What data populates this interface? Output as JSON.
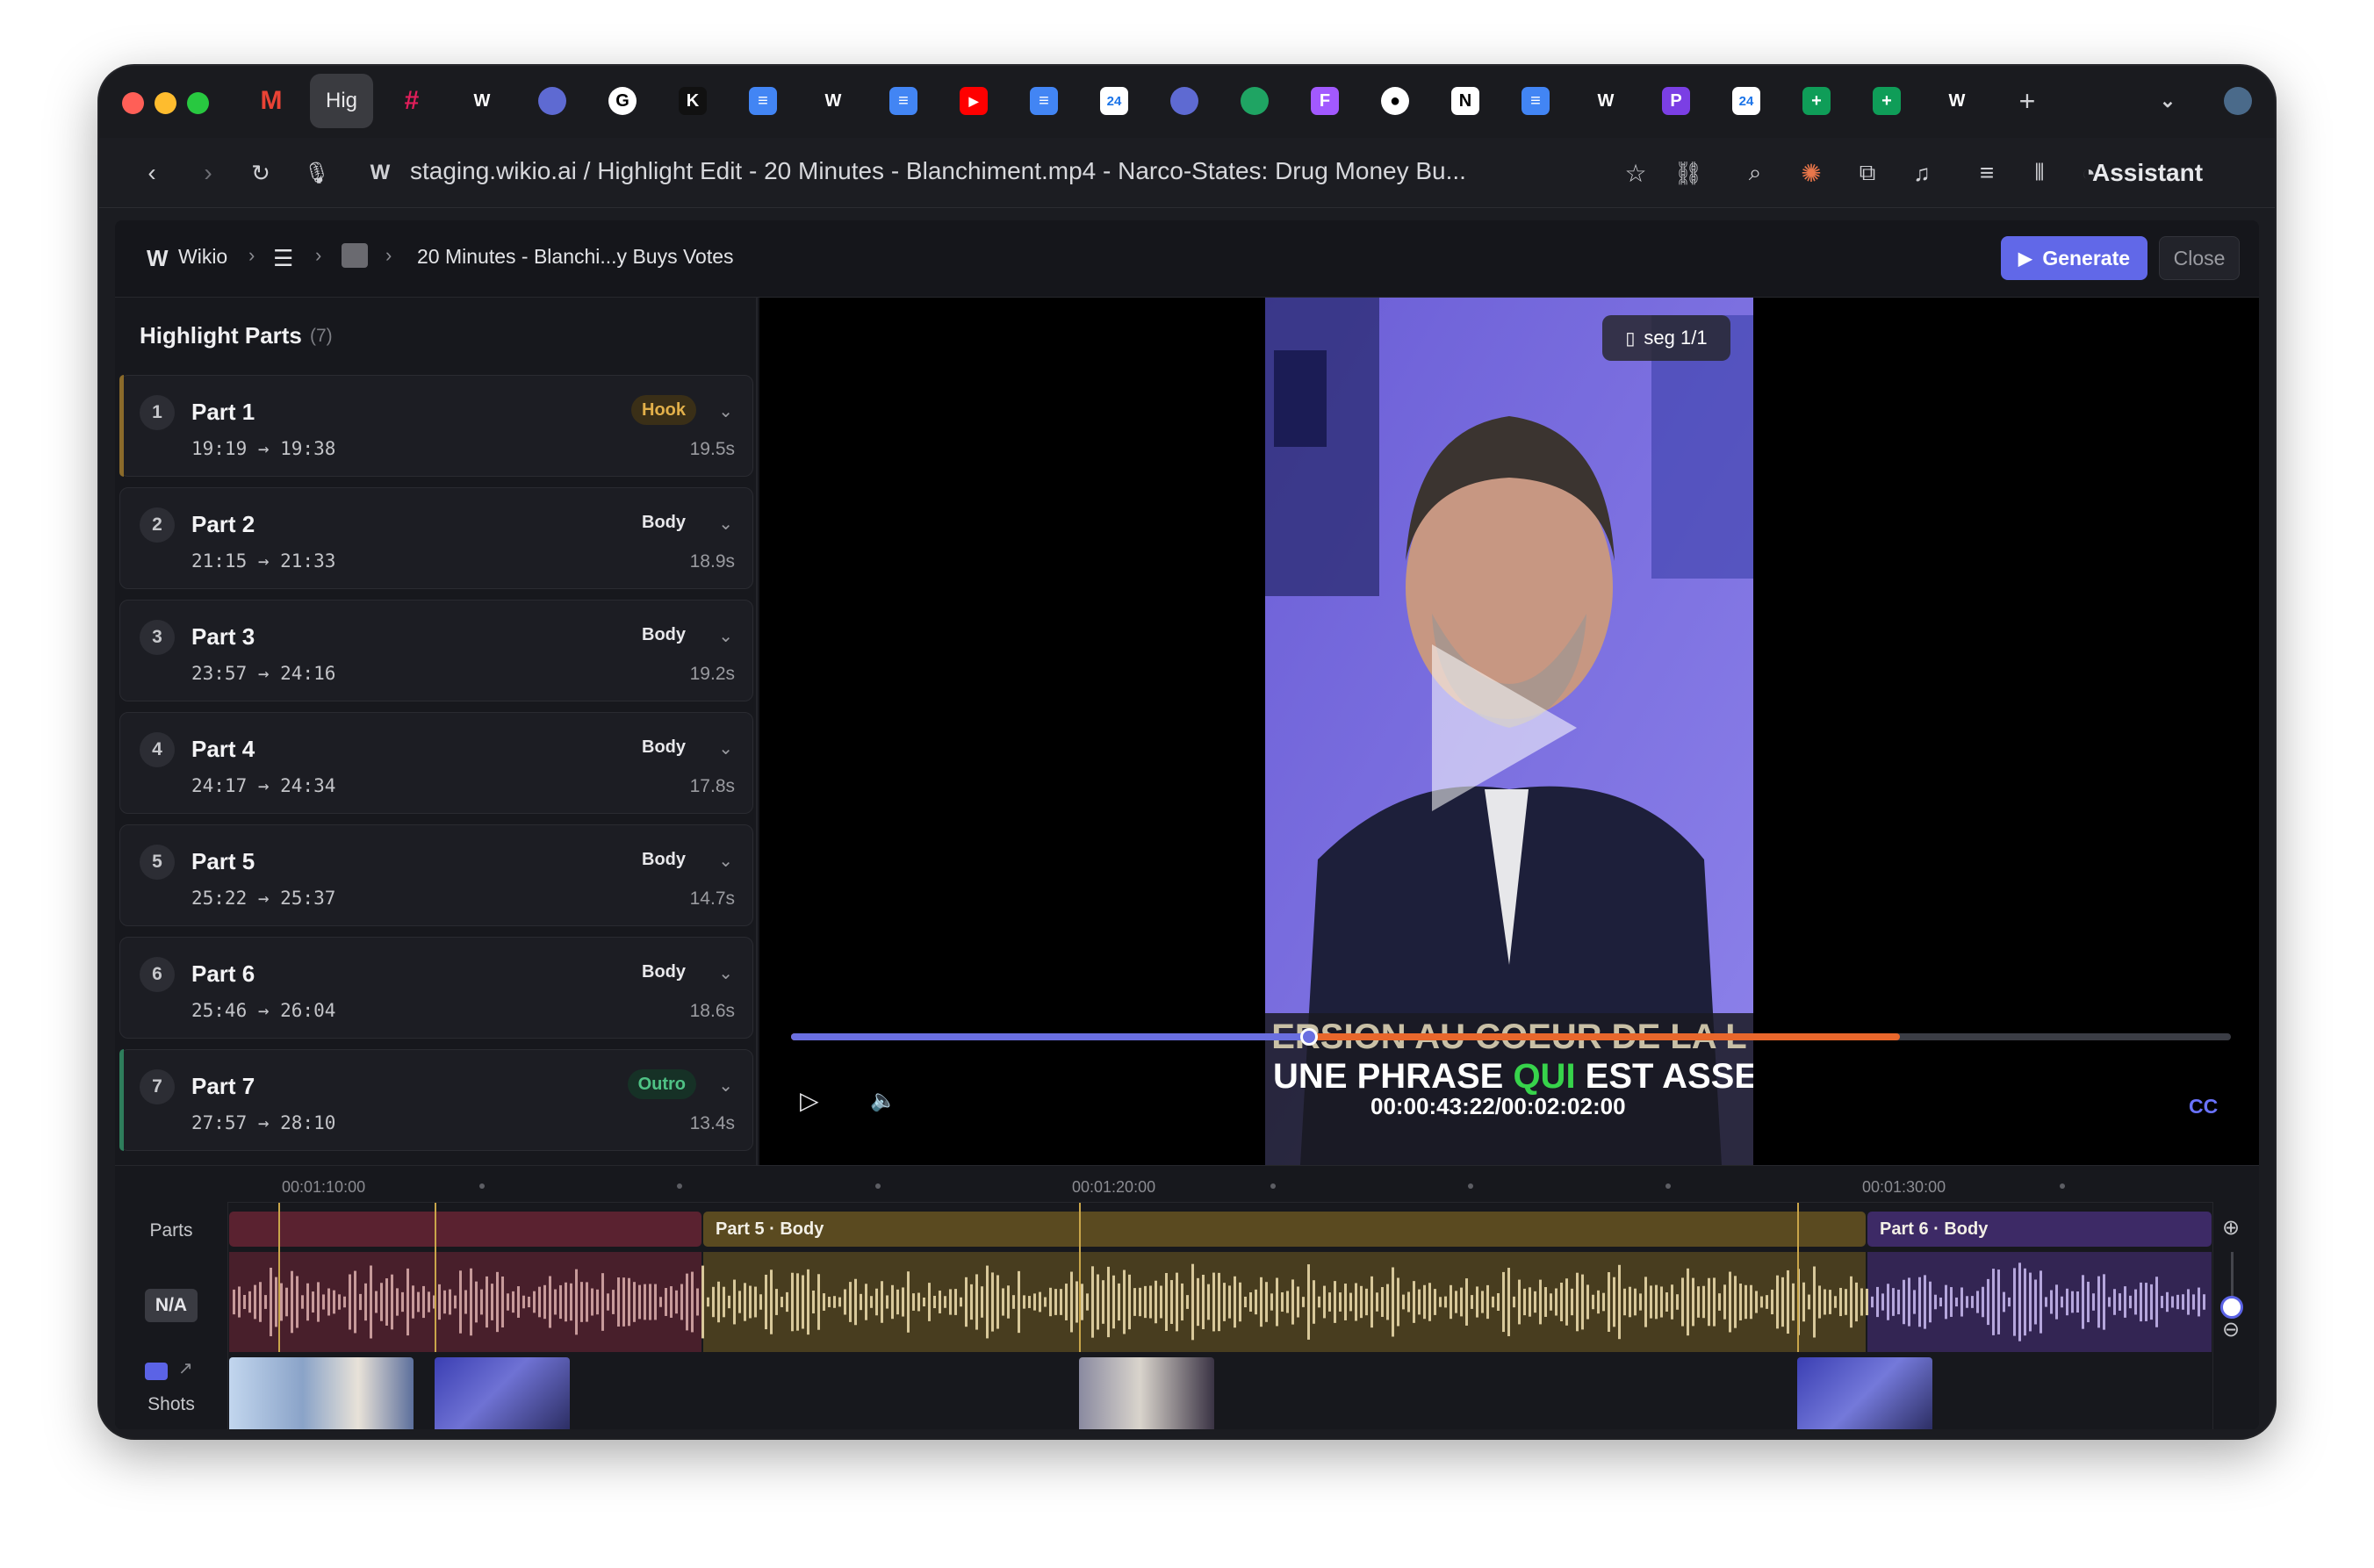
{
  "browser": {
    "active_tab_label": "Hig",
    "url": "staging.wikio.ai / Highlight Edit - 20 Minutes - Blanchiment.mp4 - Narco-States: Drug Money Bu...",
    "assistant_label": "Assistant"
  },
  "app": {
    "brand": "Wikio",
    "breadcrumb_title": "20 Minutes - Blanchi...y Buys Votes",
    "generate_label": "Generate",
    "close_label": "Close"
  },
  "panel": {
    "title": "Highlight Parts",
    "count": "(7)",
    "parts": [
      {
        "num": "1",
        "name": "Part 1",
        "time": "19:19 → 19:38",
        "tag": "Hook",
        "duration": "19.5s"
      },
      {
        "num": "2",
        "name": "Part 2",
        "time": "21:15 → 21:33",
        "tag": "Body",
        "duration": "18.9s"
      },
      {
        "num": "3",
        "name": "Part 3",
        "time": "23:57 → 24:16",
        "tag": "Body",
        "duration": "19.2s"
      },
      {
        "num": "4",
        "name": "Part 4",
        "time": "24:17 → 24:34",
        "tag": "Body",
        "duration": "17.8s"
      },
      {
        "num": "5",
        "name": "Part 5",
        "time": "25:22 → 25:37",
        "tag": "Body",
        "duration": "14.7s"
      },
      {
        "num": "6",
        "name": "Part 6",
        "time": "25:46 → 26:04",
        "tag": "Body",
        "duration": "18.6s"
      },
      {
        "num": "7",
        "name": "Part 7",
        "time": "27:57 → 28:10",
        "tag": "Outro",
        "duration": "13.4s"
      }
    ]
  },
  "player": {
    "seg_label": "seg 1/1",
    "caption_top": "ERSION AU COEUR DE LA L",
    "caption_a": "A UNE PHRASE ",
    "caption_b": "QUI",
    "caption_c": " EST ASSEZ",
    "timecode": "00:00:43:22/00:02:02:00",
    "cc_label": "CC",
    "progress": 0.36,
    "buffered": 0.77
  },
  "timeline": {
    "ruler": [
      "00:01:10:00",
      "00:01:20:00",
      "00:01:30:00"
    ],
    "row_parts_label": "Parts",
    "row_audio_label": "N/A",
    "row_shots_label": "Shots",
    "seg5_label": "Part 5 · Body",
    "seg6_label": "Part 6 · Body"
  },
  "colors": {
    "accent": "#6168e8",
    "hook": "#e2b04a",
    "outro": "#4fc285",
    "seg_part4": "#5a2230",
    "seg_part5": "#5a4a20",
    "seg_part6": "#3d2a66",
    "progress": "#6a6fe0",
    "buffer": "#e8672c"
  }
}
